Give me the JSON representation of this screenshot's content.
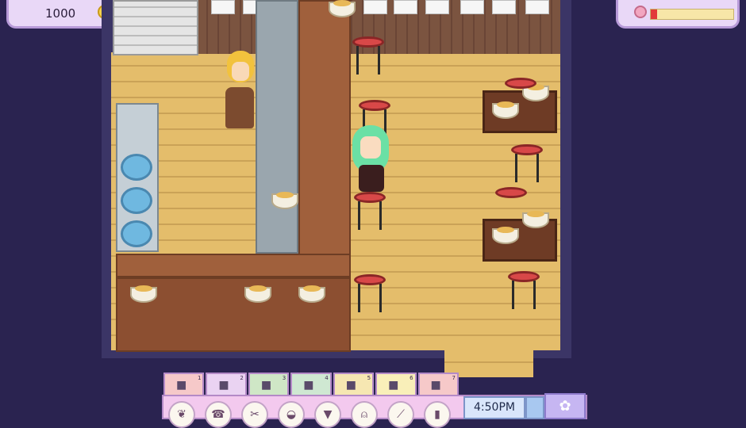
{
  "hud": {
    "money": "1000",
    "coin_icon": "coin-icon",
    "mood_icon": "flower-icon",
    "mood_level": 0.08,
    "mood_color": "#e23a3a"
  },
  "toolbar": {
    "tabs": [
      {
        "num": "1",
        "icon": "bag-icon",
        "color": "#f6c9c9"
      },
      {
        "num": "2",
        "icon": "card-icon",
        "color": "#ead3f2"
      },
      {
        "num": "3",
        "icon": "flower-plant-icon",
        "color": "#cfe7c6"
      },
      {
        "num": "4",
        "icon": "map-icon",
        "color": "#cfe8d2"
      },
      {
        "num": "5",
        "icon": "city-icon",
        "color": "#f6e7b2"
      },
      {
        "num": "6",
        "icon": "moon-icon",
        "color": "#f9efb9"
      },
      {
        "num": "7",
        "icon": "gear-icon",
        "color": "#f6c9c9"
      }
    ],
    "tools": [
      {
        "icon": "sprout-icon",
        "glyph": "❦"
      },
      {
        "icon": "phone-icon",
        "glyph": "☎"
      },
      {
        "icon": "tongs-icon",
        "glyph": "✂"
      },
      {
        "icon": "bowl-icon",
        "glyph": "◒"
      },
      {
        "icon": "ice-cream-icon",
        "glyph": "▼"
      },
      {
        "icon": "bell-icon",
        "glyph": "⍝"
      },
      {
        "icon": "knife-icon",
        "glyph": "⟋"
      },
      {
        "icon": "drink-icon",
        "glyph": "▮"
      }
    ],
    "time": "4:50PM",
    "day_icon": "flower-icon",
    "day_glyph": "✿"
  }
}
